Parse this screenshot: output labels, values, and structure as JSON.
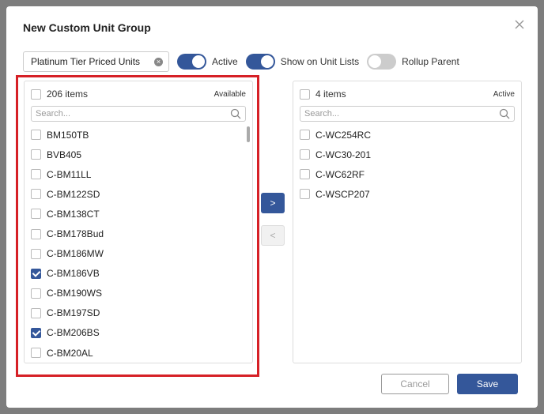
{
  "dialog": {
    "title": "New Custom Unit Group",
    "name_value": "Platinum Tier Priced Units",
    "toggles": [
      {
        "label": "Active",
        "on": true
      },
      {
        "label": "Show on Unit Lists",
        "on": true
      },
      {
        "label": "Rollup Parent",
        "on": false
      }
    ]
  },
  "available": {
    "count": "206 items",
    "tag": "Available",
    "search_placeholder": "Search...",
    "items": [
      {
        "label": "BM150TB",
        "checked": false
      },
      {
        "label": "BVB405",
        "checked": false
      },
      {
        "label": "C-BM11LL",
        "checked": false
      },
      {
        "label": "C-BM122SD",
        "checked": false
      },
      {
        "label": "C-BM138CT",
        "checked": false
      },
      {
        "label": "C-BM178Bud",
        "checked": false
      },
      {
        "label": "C-BM186MW",
        "checked": false
      },
      {
        "label": "C-BM186VB",
        "checked": true
      },
      {
        "label": "C-BM190WS",
        "checked": false
      },
      {
        "label": "C-BM197SD",
        "checked": false
      },
      {
        "label": "C-BM206BS",
        "checked": true
      },
      {
        "label": "C-BM20AL",
        "checked": false
      }
    ]
  },
  "active": {
    "count": "4 items",
    "tag": "Active",
    "search_placeholder": "Search...",
    "items": [
      {
        "label": "C-WC254RC",
        "checked": false
      },
      {
        "label": "C-WC30-201",
        "checked": false
      },
      {
        "label": "C-WC62RF",
        "checked": false
      },
      {
        "label": "C-WSCP207",
        "checked": false
      }
    ]
  },
  "transfer": {
    "right_label": ">",
    "left_label": "<"
  },
  "footer": {
    "cancel_label": "Cancel",
    "save_label": "Save"
  },
  "colors": {
    "accent": "#34579a",
    "highlight": "#d62026"
  }
}
